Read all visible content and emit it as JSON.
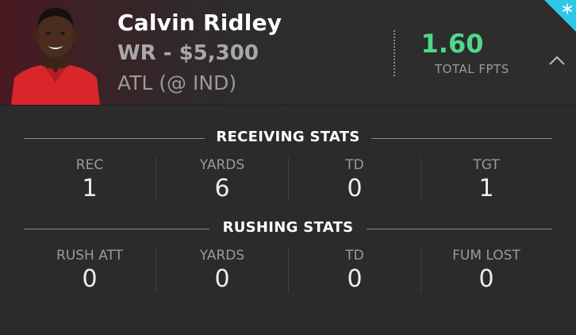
{
  "player": {
    "name": "Calvin Ridley",
    "position_salary": "WR - $5,300",
    "matchup": "ATL (@ IND)"
  },
  "fpts": {
    "value": "1.60",
    "label": "TOTAL FPTS",
    "value_color": "#4fd88a"
  },
  "icons": {
    "collapse": "chevron-up-icon",
    "badge": "snowflake-icon"
  },
  "colors": {
    "badge": "#2fc7e8",
    "jersey": "#d8262b"
  },
  "receiving": {
    "title": "RECEIVING STATS",
    "stats": [
      {
        "label": "REC",
        "value": "1"
      },
      {
        "label": "YARDS",
        "value": "6"
      },
      {
        "label": "TD",
        "value": "0"
      },
      {
        "label": "TGT",
        "value": "1"
      }
    ]
  },
  "rushing": {
    "title": "RUSHING STATS",
    "stats": [
      {
        "label": "RUSH ATT",
        "value": "0"
      },
      {
        "label": "YARDS",
        "value": "0"
      },
      {
        "label": "TD",
        "value": "0"
      },
      {
        "label": "FUM LOST",
        "value": "0"
      }
    ]
  }
}
